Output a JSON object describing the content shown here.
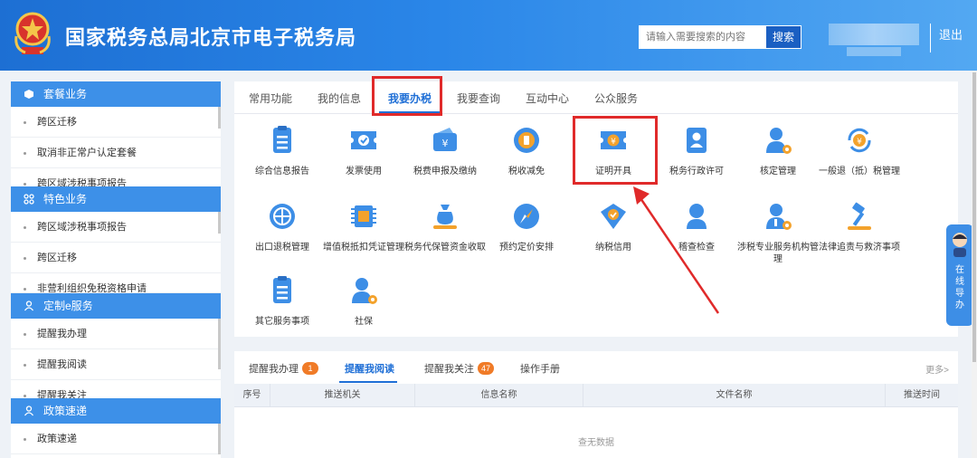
{
  "header": {
    "title": "国家税务总局北京市电子税务局",
    "search_placeholder": "请输入需要搜索的内容",
    "search_button": "搜索",
    "logout": "退出"
  },
  "sidebar": {
    "sections": [
      {
        "title": "套餐业务",
        "icon": "cube-icon",
        "items": [
          "跨区迁移",
          "取消非正常户认定套餐",
          "跨区域涉税事项报告"
        ]
      },
      {
        "title": "特色业务",
        "icon": "grid-icon",
        "items": [
          "跨区域涉税事项报告",
          "跨区迁移",
          "非营利组织免税资格申请"
        ]
      },
      {
        "title": "定制e服务",
        "icon": "user-icon",
        "items": [
          "提醒我办理",
          "提醒我阅读",
          "提醒我关注"
        ]
      },
      {
        "title": "政策速递",
        "icon": "user-icon",
        "items": [
          "政策速递"
        ]
      }
    ]
  },
  "main": {
    "tabs": [
      "常用功能",
      "我的信息",
      "我要办税",
      "我要查询",
      "互动中心",
      "公众服务"
    ],
    "active_tab": "我要办税",
    "services": [
      {
        "label": "综合信息报告",
        "icon": "document-list-icon"
      },
      {
        "label": "发票使用",
        "icon": "invoice-ticket-icon"
      },
      {
        "label": "税费申报及缴纳",
        "icon": "wallet-yuan-icon"
      },
      {
        "label": "税收减免",
        "icon": "coin-icon"
      },
      {
        "label": "证明开具",
        "icon": "certificate-ticket-icon"
      },
      {
        "label": "税务行政许可",
        "icon": "id-badge-icon"
      },
      {
        "label": "核定管理",
        "icon": "person-gear-icon"
      },
      {
        "label": "一般退（抵）税管理",
        "icon": "refund-cycle-icon"
      },
      {
        "label": "出口退税管理",
        "icon": "globe-icon"
      },
      {
        "label": "增值税抵扣凭证管理",
        "icon": "chip-icon"
      },
      {
        "label": "税务代保管资金收取",
        "icon": "money-bag-icon"
      },
      {
        "label": "预约定价安排",
        "icon": "compass-icon"
      },
      {
        "label": "纳税信用",
        "icon": "shield-check-icon"
      },
      {
        "label": "稽查检查",
        "icon": "inspector-icon"
      },
      {
        "label": "涉税专业服务机构管理",
        "icon": "person-info-gear-icon"
      },
      {
        "label": "法律追责与救济事项",
        "icon": "gavel-icon"
      },
      {
        "label": "其它服务事项",
        "icon": "document-list-icon"
      },
      {
        "label": "社保",
        "icon": "person-gear-icon"
      }
    ]
  },
  "reminders": {
    "tabs": [
      {
        "label": "提醒我办理",
        "badge": "1"
      },
      {
        "label": "提醒我阅读",
        "badge": ""
      },
      {
        "label": "提醒我关注",
        "badge": "47"
      },
      {
        "label": "操作手册",
        "badge": ""
      }
    ],
    "active_tab": "提醒我阅读",
    "more": "更多>",
    "columns": [
      "序号",
      "推送机关",
      "信息名称",
      "文件名称",
      "推送时间"
    ],
    "empty_text": "查无数据"
  },
  "guide": {
    "label": "在线导办"
  },
  "colors": {
    "brand": "#2a86e8",
    "accent": "#1f6fd6",
    "highlight": "#e02a2a",
    "badge": "#f07b27"
  }
}
